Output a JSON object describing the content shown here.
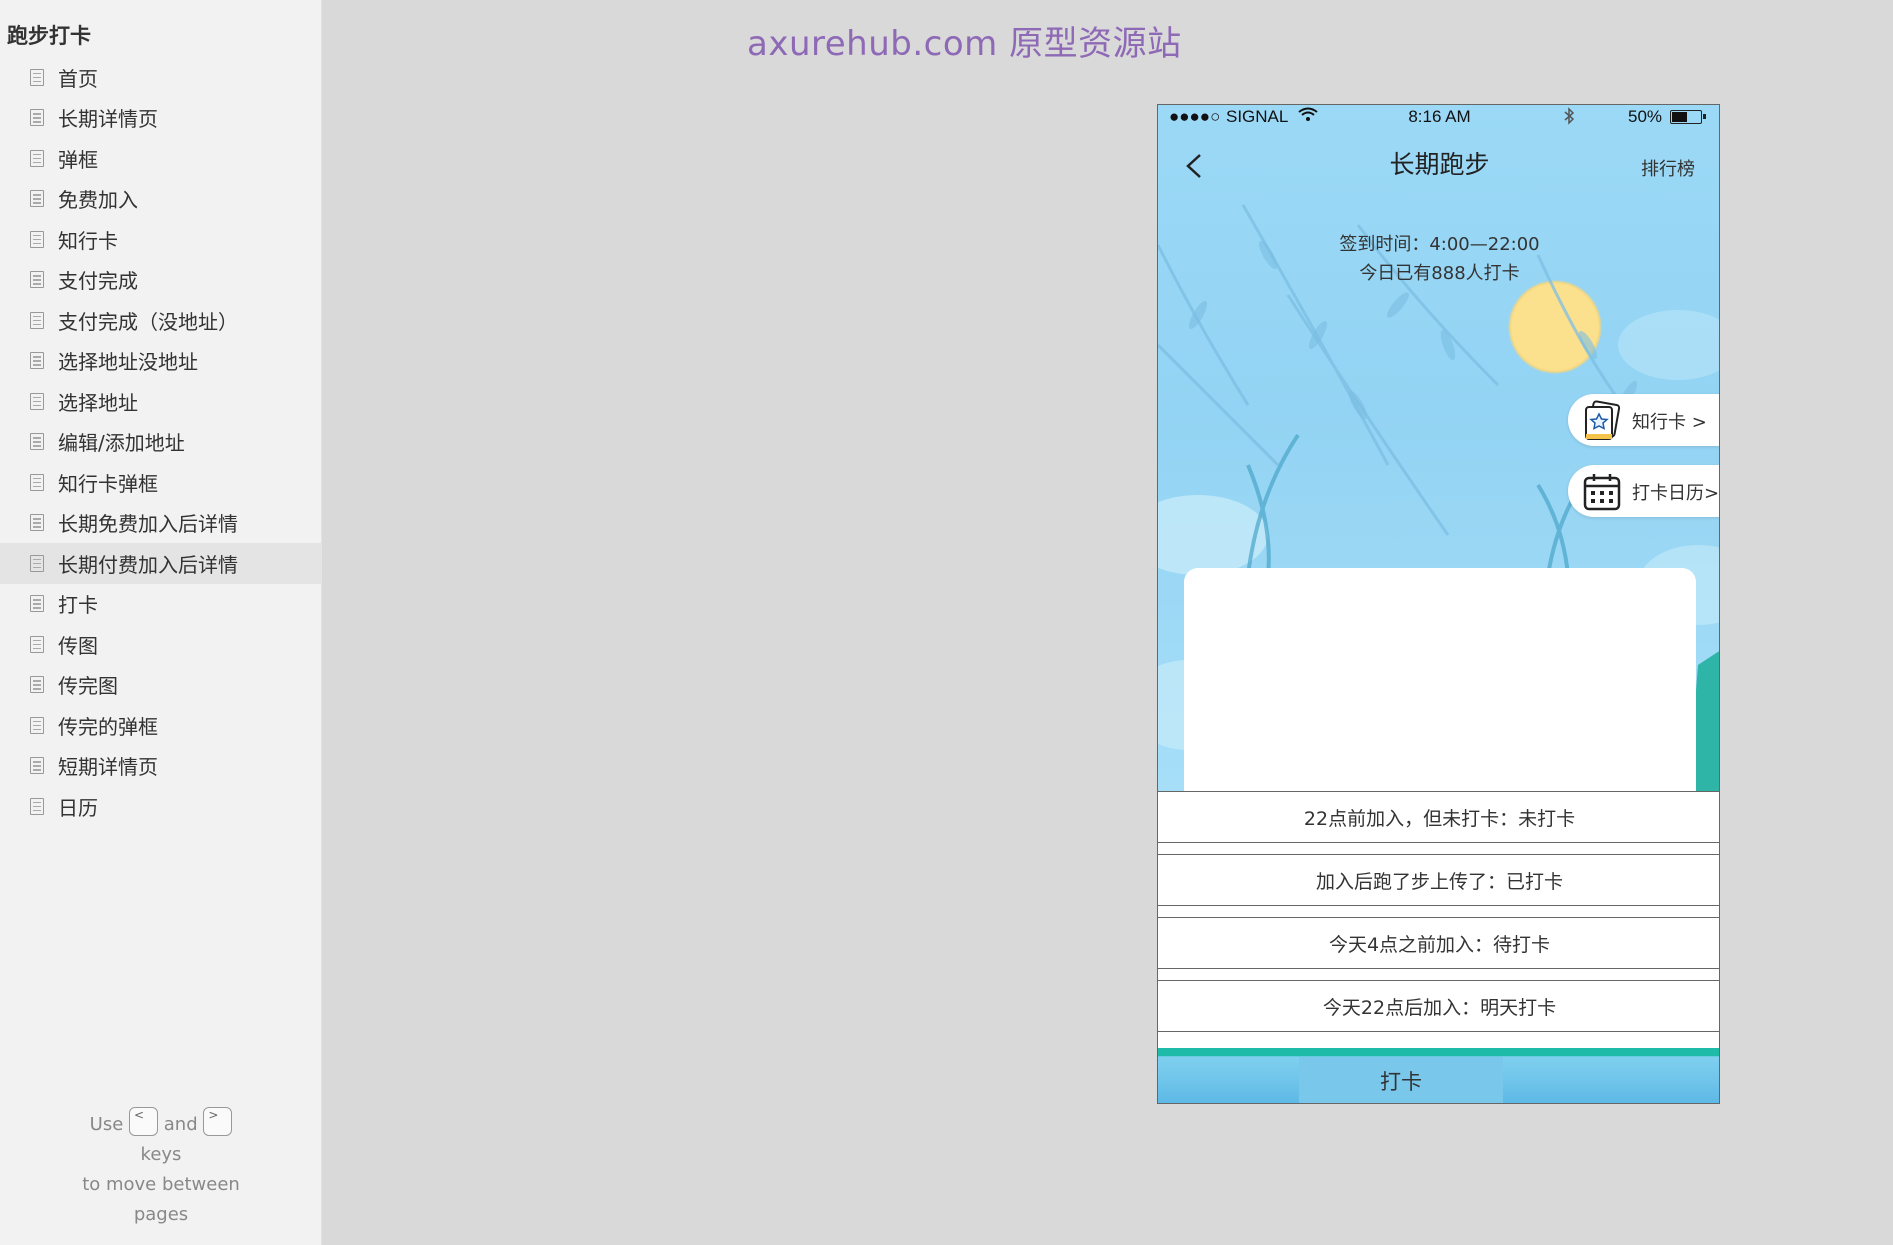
{
  "sidebar": {
    "title": "跑步打卡",
    "items": [
      {
        "label": "首页"
      },
      {
        "label": "长期详情页"
      },
      {
        "label": "弹框"
      },
      {
        "label": "免费加入"
      },
      {
        "label": "知行卡"
      },
      {
        "label": "支付完成"
      },
      {
        "label": "支付完成（没地址）"
      },
      {
        "label": "选择地址没地址"
      },
      {
        "label": "选择地址"
      },
      {
        "label": "编辑/添加地址"
      },
      {
        "label": "知行卡弹框"
      },
      {
        "label": "长期免费加入后详情"
      },
      {
        "label": "长期付费加入后详情",
        "active": true
      },
      {
        "label": "打卡"
      },
      {
        "label": "传图"
      },
      {
        "label": "传完图"
      },
      {
        "label": "传完的弹框"
      },
      {
        "label": "短期详情页"
      },
      {
        "label": "日历"
      }
    ],
    "hint": {
      "use": "Use",
      "prev_key": "<",
      "and": "and",
      "next_key": ">",
      "keys": "keys",
      "move": "to move between",
      "pages": "pages"
    }
  },
  "watermark": "axurehub.com 原型资源站",
  "phone": {
    "statusbar": {
      "signal": "●●●●○",
      "carrier": "SIGNAL",
      "time": "8:16 AM",
      "battery": "50%"
    },
    "nav": {
      "title": "长期跑步",
      "right": "排行榜"
    },
    "checkin_time": "签到时间：4:00—22:00",
    "checkin_count": "今日已有888人打卡",
    "pills": {
      "card": "知行卡 >",
      "calendar": "打卡日历>"
    },
    "states": [
      {
        "label": "22点前加入，但未打卡：未打卡"
      },
      {
        "label": "加入后跑了步上传了：已打卡"
      },
      {
        "label": "今天4点之前加入：待打卡"
      },
      {
        "label": "今天22点后加入：明天打卡"
      }
    ],
    "checkin_button": "打卡"
  },
  "colors": {
    "sky": "#9bd9f6",
    "sun": "#fbe08e",
    "teal": "#1ebba8",
    "watermark": "#8e69b5"
  }
}
